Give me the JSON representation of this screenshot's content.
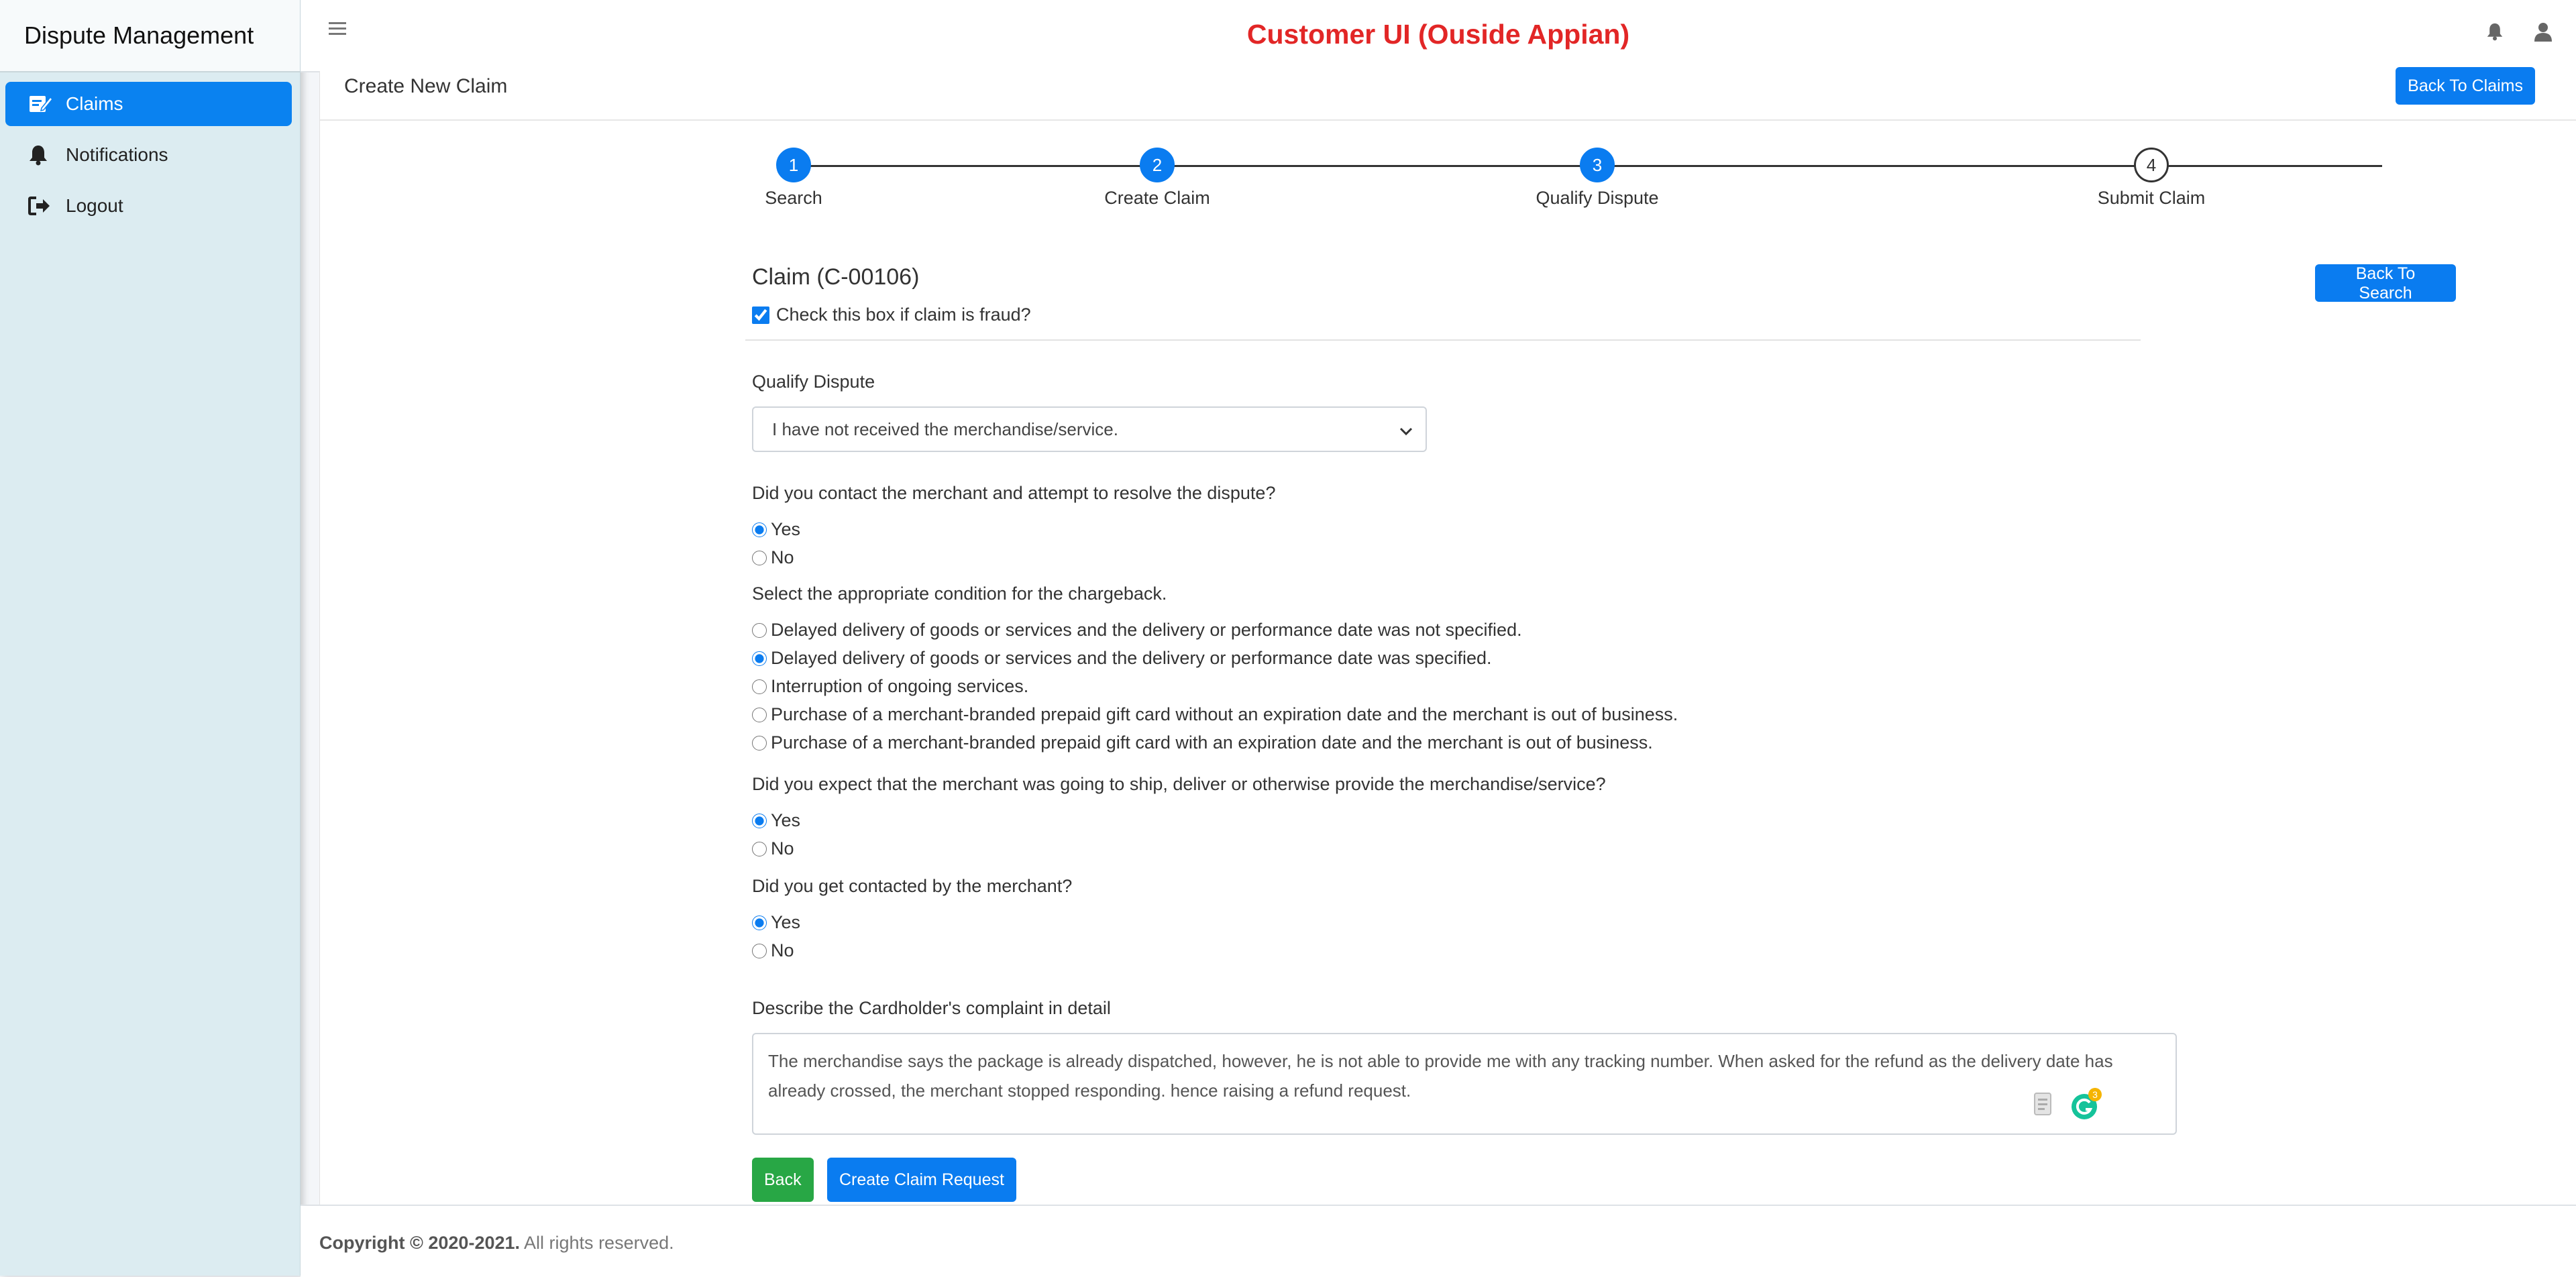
{
  "sidebar": {
    "brand": "Dispute Management",
    "items": [
      {
        "label": "Claims",
        "icon": "edit-icon",
        "active": true
      },
      {
        "label": "Notifications",
        "icon": "bell-icon",
        "active": false
      },
      {
        "label": "Logout",
        "icon": "logout-icon",
        "active": false
      }
    ]
  },
  "topbar": {
    "title": "Customer UI (Ouside Appian)",
    "title_color": "#e22626",
    "icons": [
      "menu-icon",
      "bell-icon",
      "user-icon"
    ]
  },
  "card": {
    "title": "Create New Claim",
    "back_to_claims": "Back To Claims"
  },
  "stepper": {
    "steps": [
      {
        "number": "1",
        "label": "Search",
        "state": "complete"
      },
      {
        "number": "2",
        "label": "Create Claim",
        "state": "complete"
      },
      {
        "number": "3",
        "label": "Qualify Dispute",
        "state": "active"
      },
      {
        "number": "4",
        "label": "Submit Claim",
        "state": "pending"
      }
    ]
  },
  "claim": {
    "heading": "Claim (C-00106)",
    "back_to_search": "Back To Search",
    "fraud_label": "Check this box if claim is fraud?",
    "fraud_checked": true
  },
  "form": {
    "qualify_label": "Qualify Dispute",
    "qualify_value": "I have not received the merchandise/service.",
    "q1": {
      "label": "Did you contact the merchant and attempt to resolve the dispute?",
      "options": [
        "Yes",
        "No"
      ],
      "selected": "Yes"
    },
    "q2": {
      "label": "Select the appropriate condition for the chargeback.",
      "options": [
        "Delayed delivery of goods or services and the delivery or performance date was not specified.",
        "Delayed delivery of goods or services and the delivery or performance date was specified.",
        "Interruption of ongoing services.",
        "Purchase of a merchant-branded prepaid gift card without an expiration date and the merchant is out of business.",
        "Purchase of a merchant-branded prepaid gift card with an expiration date and the merchant is out of business."
      ],
      "selected": "Delayed delivery of goods or services and the delivery or performance date was specified."
    },
    "q3": {
      "label": "Did you expect that the merchant was going to ship, deliver or otherwise provide the merchandise/service?",
      "options": [
        "Yes",
        "No"
      ],
      "selected": "Yes"
    },
    "q4": {
      "label": "Did you get contacted by the merchant?",
      "options": [
        "Yes",
        "No"
      ],
      "selected": "Yes"
    },
    "complaint_label": "Describe the Cardholder's complaint in detail",
    "complaint_value": "The merchandise says the package is already dispatched, however, he is not able to provide me with any tracking number. When asked for the refund as the delivery date has already crossed, the merchant stopped responding. hence raising a refund request.",
    "grammarly_badge": "3",
    "back_button": "Back",
    "create_button": "Create Claim Request"
  },
  "footer": {
    "copyright": "Copyright © 2020-2021.",
    "rights": "All rights reserved."
  }
}
